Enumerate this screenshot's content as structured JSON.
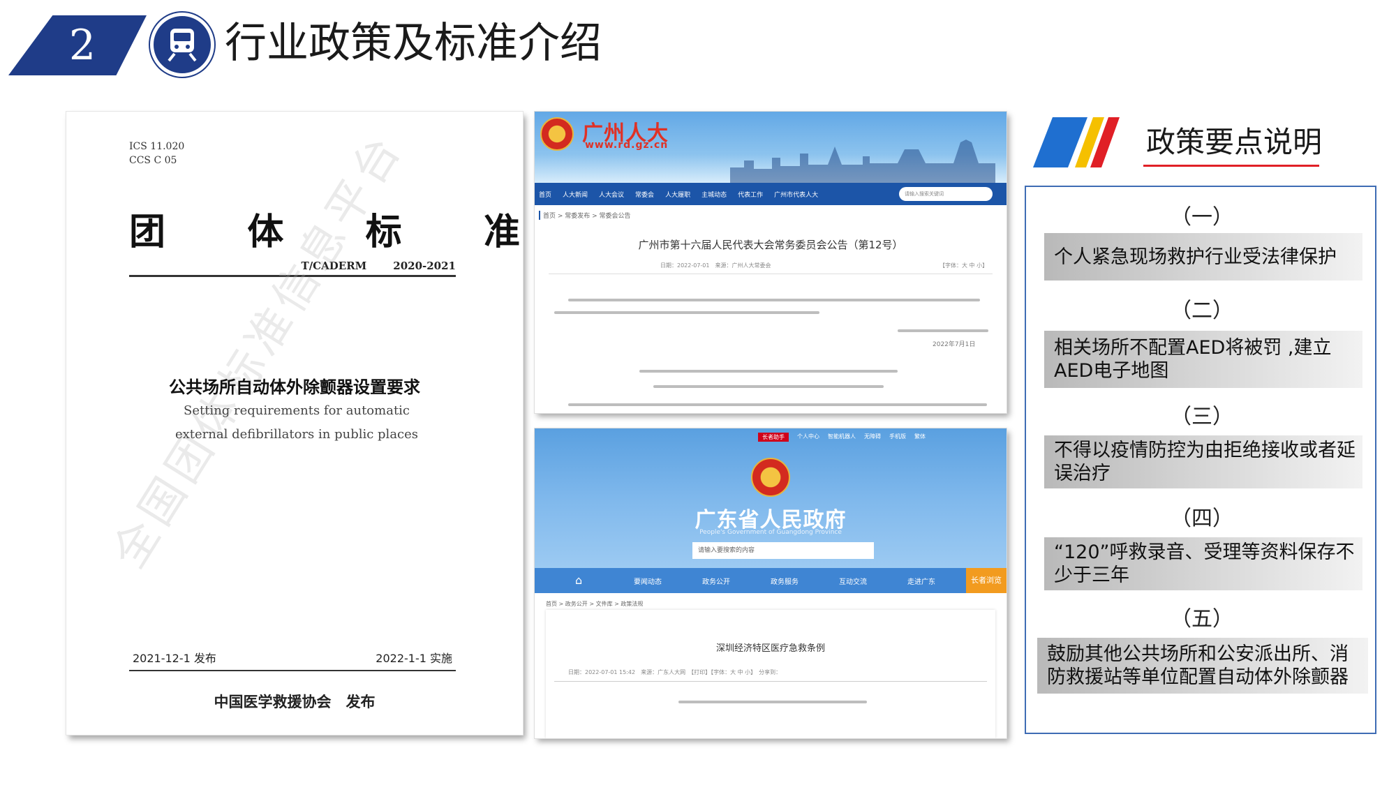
{
  "header": {
    "section_number": "2",
    "section_icon": "train-icon",
    "title": "行业政策及标准介绍",
    "brand_color": "#1f3c88"
  },
  "standard_doc": {
    "ics": "ICS 11.020",
    "ccs": "CCS C 05",
    "big_title_chars": [
      "团",
      "体",
      "标",
      "准"
    ],
    "code": "T/CADERM",
    "code_year": "2020-2021",
    "cn_title": "公共场所自动体外除颤器设置要求",
    "en_title": "Setting requirements for automatic external defibrillators in public places",
    "watermark": "全国团体标准信息平台",
    "publish_date": "2021-12-1 发布",
    "effective_date": "2022-1-1 实施",
    "issuer": "中国医学救援协会　发布"
  },
  "screenshot_rd": {
    "site_name": "广州人大",
    "site_url": "www.rd.gz.cn",
    "nav_items": [
      "首页",
      "人大新闻",
      "人大会议",
      "常委会",
      "人大履职",
      "主城动态",
      "代表工作",
      "广州市代表人大"
    ],
    "search_placeholder": "请输入搜索关键词",
    "breadcrumb": "首页 > 常委发布 > 常委会公告",
    "doc_title": "广州市第十六届人民代表大会常务委员会公告（第12号）",
    "meta_date": "日期：2022-07-01　来源：广州人大常委会",
    "meta_font": "【字体：大 中 小】",
    "footer_date": "2022年7月1日"
  },
  "screenshot_gd": {
    "top_links": [
      "长者助手",
      "个人中心",
      "智能机器人",
      "无障碍",
      "手机版",
      "繁体"
    ],
    "site_name": "广东省人民政府",
    "site_en": "People's Government of Guangdong Province",
    "search_placeholder": "请输入要搜索的内容",
    "nav_items": [
      "要闻动态",
      "政务公开",
      "政务服务",
      "互动交流",
      "走进广东"
    ],
    "nav_badge": "长者浏览",
    "breadcrumb": "首页 > 政务公开 > 文件库 > 政策法规",
    "doc_title": "深圳经济特区医疗急救条例",
    "meta": "日期：2022-07-01 15:42　来源：广东人大网　【打印】【字体：大 中 小】　分享到："
  },
  "policy_points": {
    "title": "政策要点说明",
    "accent_color": "#e01f26",
    "border_color": "#3e6cb4",
    "items": [
      {
        "num": "（一）",
        "text": "个人紧急现场救护行业受法律保护"
      },
      {
        "num": "（二）",
        "text": "相关场所不配置AED将被罚 ,建立AED电子地图"
      },
      {
        "num": "（三）",
        "text": "不得以疫情防控为由拒绝接收或者延误治疗"
      },
      {
        "num": "（四）",
        "text": "“120”呼救录音、受理等资料保存不少于三年"
      },
      {
        "num": "（五）",
        "text": "鼓励其他公共场所和公安派出所、消防救援站等单位配置自动体外除颤器"
      }
    ]
  }
}
